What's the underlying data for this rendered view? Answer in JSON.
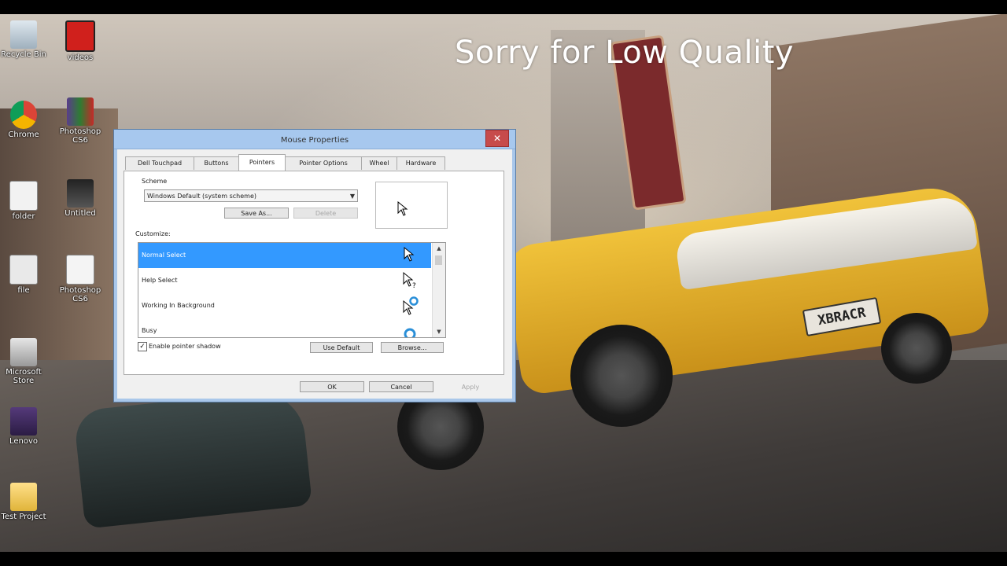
{
  "watermark": "Sorry for Low Quality",
  "desktop": {
    "icons": [
      {
        "label": "Recycle Bin"
      },
      {
        "label": "videos"
      },
      {
        "label": "Chrome"
      },
      {
        "label": "Photoshop CS6"
      },
      {
        "label": "folder"
      },
      {
        "label": "Untitled"
      },
      {
        "label": "file"
      },
      {
        "label": "Photoshop CS6"
      },
      {
        "label": "Microsoft Store"
      },
      {
        "label": "Lenovo"
      },
      {
        "label": "Test Project"
      }
    ],
    "plate_text": "XBRACR"
  },
  "dialog": {
    "title": "Mouse Properties",
    "close_glyph": "✕",
    "tabs": [
      "Dell Touchpad",
      "Buttons",
      "Pointers",
      "Pointer Options",
      "Wheel",
      "Hardware"
    ],
    "active_tab": "Pointers",
    "scheme_label": "Scheme",
    "scheme_value": "Windows Default (system scheme)",
    "save_as_label": "Save As...",
    "delete_label": "Delete",
    "customize_label": "Customize:",
    "pointers": [
      {
        "label": "Normal Select",
        "selected": true
      },
      {
        "label": "Help Select",
        "selected": false
      },
      {
        "label": "Working In Background",
        "selected": false
      },
      {
        "label": "Busy",
        "selected": false
      }
    ],
    "shadow_label": "Enable pointer shadow",
    "shadow_checked": true,
    "use_default_label": "Use Default",
    "browse_label": "Browse...",
    "ok_label": "OK",
    "cancel_label": "Cancel",
    "apply_label": "Apply"
  }
}
